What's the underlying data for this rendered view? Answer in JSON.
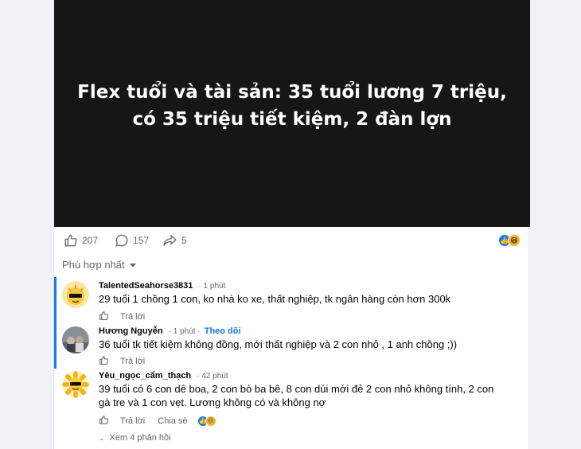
{
  "post": {
    "media_title": "Flex tuổi và tài sản: 35 tuổi lương 7 triệu, có 35 triệu tiết kiệm, 2 đàn lợn",
    "like_count": "207",
    "comment_count": "157",
    "share_count": "5",
    "reactions": [
      "like-icon",
      "haha-icon"
    ]
  },
  "sort": {
    "label": "Phù hợp nhất"
  },
  "comments": [
    {
      "name": "TalentedSeahorse3831",
      "time": "1 phút",
      "text": "29 tuổi 1 chồng 1 con, ko nhà ko xe, thất nghiệp, tk ngân hàng còn hơn 300k",
      "reply_label": "Trả lời"
    },
    {
      "name": "Hương Nguyễn",
      "time": "1 phút",
      "follow_label": "Theo dõi",
      "text": "36 tuổi tk tiết kiệm không đồng, mới thất nghiệp và 2 con nhỏ , 1 anh chồng ;))",
      "reply_label": "Trả lời"
    },
    {
      "name": "Yêu_ngọc_cẩm_thạch",
      "time": "42 phút",
      "text": "39 tuổi có 6 con dê boa, 2 con bò ba bê, 8 con dúi mới đẻ 2 con nhỏ không tính, 2 con gà tre và 1 con vẹt. Lương không có và không nợ",
      "reply_label": "Trả lời",
      "share_label": "Chia sẻ",
      "view_replies": "Xem 4 phản hồi"
    }
  ],
  "colors": {
    "accent": "#1877f2",
    "muted": "#65676b",
    "media_bg": "#161616"
  }
}
